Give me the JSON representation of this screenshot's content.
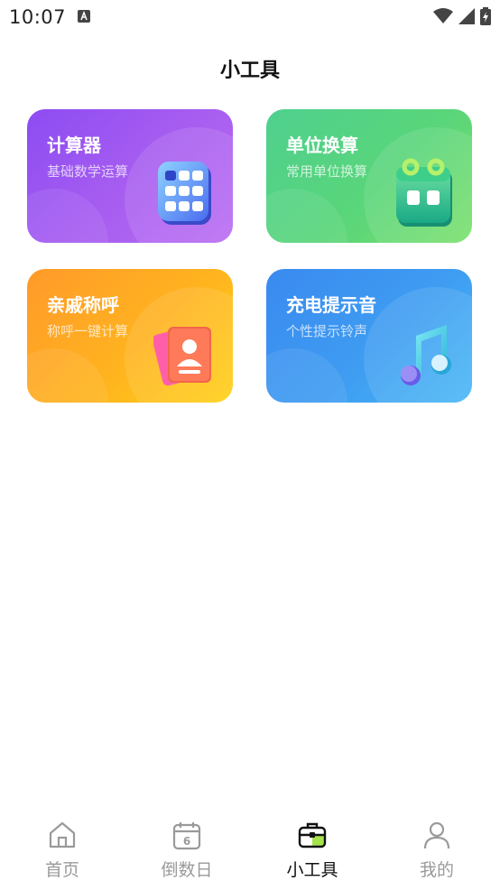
{
  "status_bar": {
    "time": "10:07",
    "icons": [
      "notification-a-icon",
      "wifi-icon",
      "signal-icon",
      "battery-charging-icon"
    ]
  },
  "header": {
    "title": "小工具"
  },
  "tools": [
    {
      "title": "计算器",
      "subtitle": "基础数学运算",
      "icon": "calculator-icon",
      "color": "#9a55f1"
    },
    {
      "title": "单位换算",
      "subtitle": "常用单位换算",
      "icon": "calendar-icon",
      "color": "#55d37f"
    },
    {
      "title": "亲戚称呼",
      "subtitle": "称呼一键计算",
      "icon": "contact-card-icon",
      "color": "#ffae22"
    },
    {
      "title": "充电提示音",
      "subtitle": "个性提示铃声",
      "icon": "music-note-icon",
      "color": "#3f9ef2"
    }
  ],
  "tabbar": {
    "items": [
      {
        "label": "首页",
        "icon": "home-icon",
        "active": false
      },
      {
        "label": "倒数日",
        "icon": "calendar-6-icon",
        "active": false
      },
      {
        "label": "小工具",
        "icon": "toolbox-icon",
        "active": true
      },
      {
        "label": "我的",
        "icon": "user-icon",
        "active": false
      }
    ],
    "calendar_icon_day": "6",
    "active_color": "#111111",
    "inactive_color": "#9a9a9a",
    "accent_color": "#a6e34a"
  }
}
